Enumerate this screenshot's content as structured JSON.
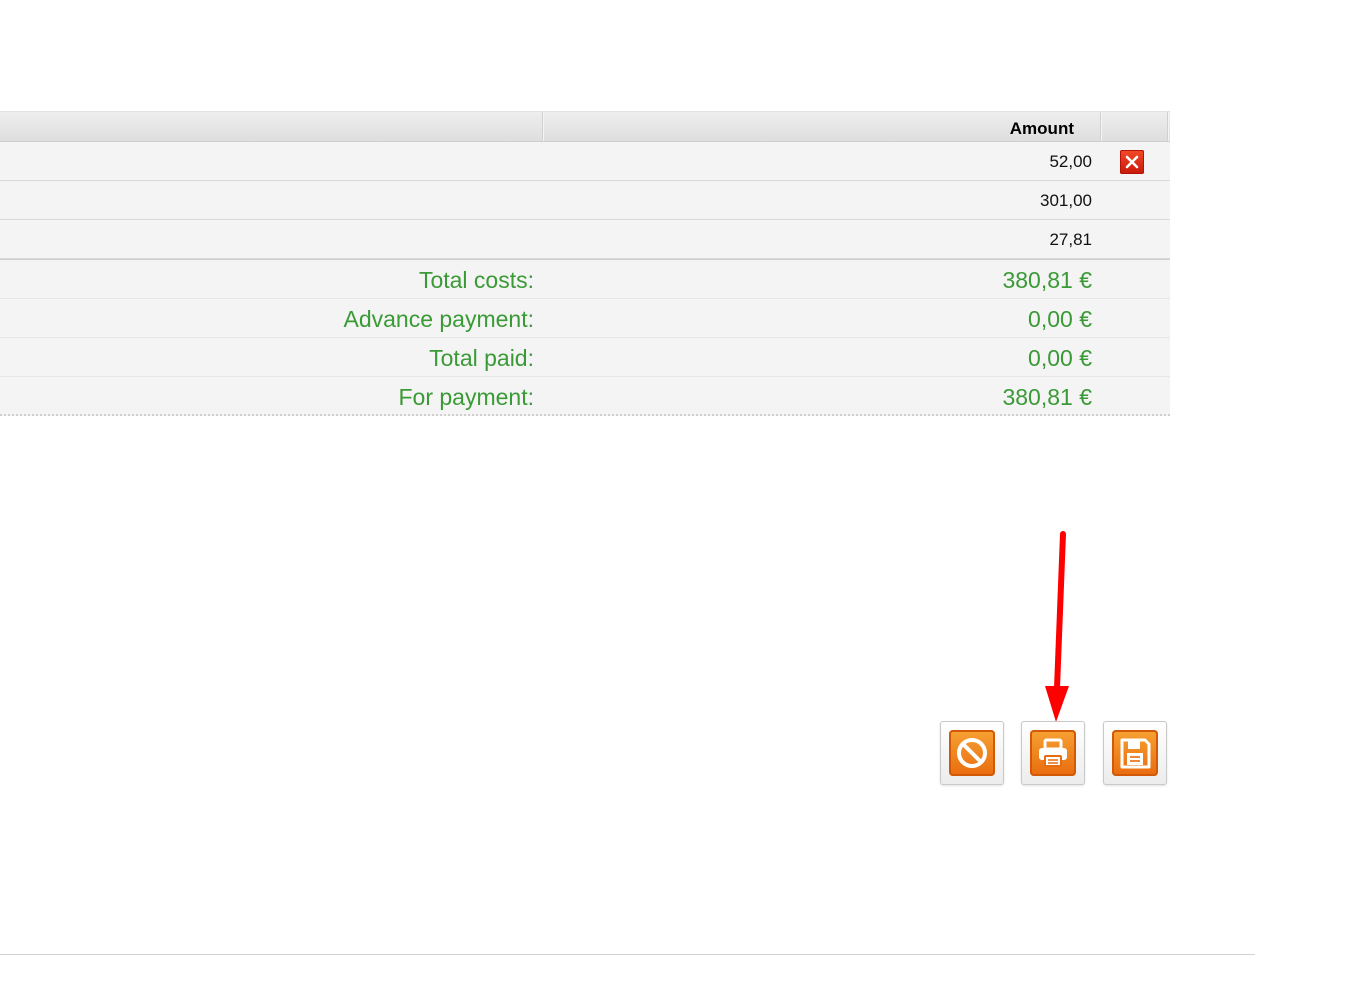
{
  "grid": {
    "columns": {
      "amount": "Amount"
    },
    "rows": [
      {
        "amount": "52,00",
        "deletable": true
      },
      {
        "amount": "301,00",
        "deletable": false
      },
      {
        "amount": "27,81",
        "deletable": false
      }
    ]
  },
  "totals": [
    {
      "label": "Total costs:",
      "value": "380,81 €"
    },
    {
      "label": "Advance payment:",
      "value": "0,00 €"
    },
    {
      "label": "Total paid:",
      "value": "0,00 €"
    },
    {
      "label": "For payment:",
      "value": "380,81 €"
    }
  ],
  "actions": {
    "cancel": {
      "icon": "cancel-icon"
    },
    "print": {
      "icon": "printer-icon"
    },
    "save": {
      "icon": "floppy-disk-icon"
    }
  },
  "colors": {
    "totals_text": "#3a9a36",
    "action_orange": "#e96b0f",
    "delete_red": "#d9200f",
    "annotation_arrow": "#ff0000"
  }
}
